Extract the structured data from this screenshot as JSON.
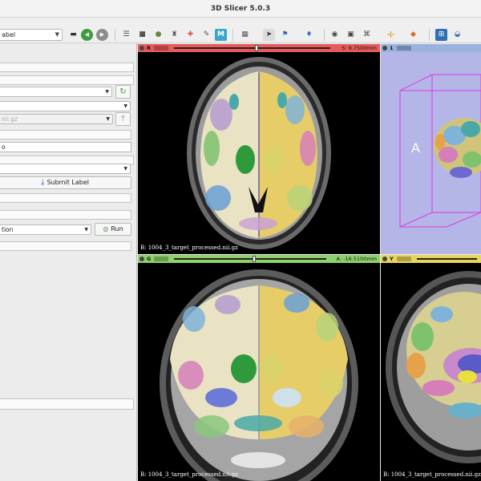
{
  "window": {
    "title": "3D Slicer 5.0.3"
  },
  "toolbar": {
    "module_select": "abel",
    "buttons": [
      {
        "name": "layout-icon",
        "glyph": "▬"
      },
      {
        "name": "back-icon",
        "glyph": "◀"
      },
      {
        "name": "forward-icon",
        "glyph": "▶"
      },
      {
        "name": "data-icon",
        "glyph": "☰"
      },
      {
        "name": "volumes-icon",
        "glyph": "■"
      },
      {
        "name": "models-icon",
        "glyph": "●"
      },
      {
        "name": "transforms-icon",
        "glyph": "♜"
      },
      {
        "name": "markups-icon",
        "glyph": "✚"
      },
      {
        "name": "editor-icon",
        "glyph": "✎"
      },
      {
        "name": "monai-label-icon",
        "glyph": "M"
      },
      {
        "name": "screenshot-icon",
        "glyph": "▦"
      },
      {
        "name": "pointer-icon",
        "glyph": "➤"
      },
      {
        "name": "place-icon",
        "glyph": "⚑"
      },
      {
        "name": "crosshair-toggle-icon",
        "glyph": "♦"
      },
      {
        "name": "capture-icon",
        "glyph": "◉"
      },
      {
        "name": "record-icon",
        "glyph": "▣"
      },
      {
        "name": "sequence-icon",
        "glyph": "⌘"
      },
      {
        "name": "crosshair-icon",
        "glyph": "✛"
      },
      {
        "name": "layers-icon",
        "glyph": "◆"
      },
      {
        "name": "extensions-icon",
        "glyph": "⊞"
      },
      {
        "name": "python-icon",
        "glyph": "◒"
      }
    ]
  },
  "left_panel": {
    "refresh_glyph": "↻",
    "upload_glyph": "⤒",
    "disabled_volume": "nii.gz",
    "text_field": "o",
    "submit_label": "Submit Label",
    "submit_glyph": "⤓",
    "algorithm_select": "tion",
    "run_label": "Run",
    "run_glyph": "◎"
  },
  "views": {
    "red": {
      "letter": "R",
      "offset": "S: 9.7500mm",
      "volume": "B: 1004_3_target_processed.nii.gz",
      "bar_color": "#e55a5a"
    },
    "threed": {
      "letter": "1",
      "axis_label": "A",
      "bar_color": "#9ab3de"
    },
    "green": {
      "letter": "G",
      "offset": "A: -16.5100mm",
      "volume": "B: 1004_3_target_processed.nii.gz",
      "bar_color": "#8ed16a"
    },
    "yellow": {
      "letter": "Y",
      "volume": "B: 1004_3_target_processed.nii.gz",
      "bar_color": "#e8d55c"
    }
  },
  "colors": {
    "wm_left": "#e9e3c4",
    "wm_right": "#e7cd68",
    "three_d_background": "#b3b6e6",
    "bbox": "#e337e3"
  }
}
